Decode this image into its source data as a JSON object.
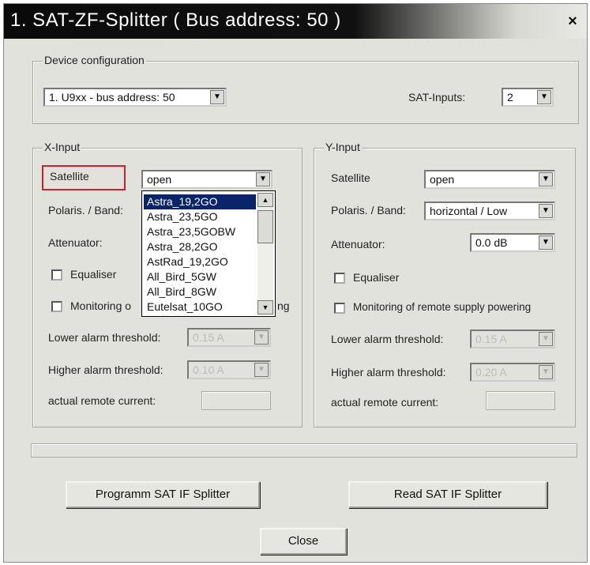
{
  "window": {
    "title": "1. SAT-ZF-Splitter ( Bus address: 50 )",
    "close_glyph": "×"
  },
  "device": {
    "legend": "Device configuration",
    "selected": "1. U9xx - bus address: 50",
    "sat_inputs_label": "SAT-Inputs:",
    "sat_inputs_value": "2"
  },
  "x_input": {
    "legend": "X-Input",
    "satellite_label": "Satellite",
    "satellite_value": "open",
    "polaris_label": "Polaris. / Band:",
    "attenuator_label": "Attenuator:",
    "equaliser_label": "Equaliser",
    "monitoring_label": "Monitoring o",
    "monitoring_tail": "ng",
    "lower_label": "Lower alarm threshold:",
    "lower_value": "0.15 A",
    "higher_label": "Higher alarm threshold:",
    "higher_value": "0.10 A",
    "current_label": "actual remote current:",
    "dropdown_items": [
      "Astra_19,2GO",
      "Astra_23,5GO",
      "Astra_23,5GOBW",
      "Astra_28,2GO",
      "AstRad_19,2GO",
      "All_Bird_5GW",
      "All_Bird_8GW",
      "Eutelsat_10GO"
    ],
    "dropdown_selected_index": 0
  },
  "y_input": {
    "legend": "Y-Input",
    "satellite_label": "Satellite",
    "satellite_value": "open",
    "polaris_label": "Polaris. / Band:",
    "polaris_value": "horizontal / Low",
    "attenuator_label": "Attenuator:",
    "attenuator_value": "0.0 dB",
    "equaliser_label": "Equaliser",
    "monitoring_label": "Monitoring of remote supply powering",
    "lower_label": "Lower alarm threshold:",
    "lower_value": "0.15 A",
    "higher_label": "Higher alarm threshold:",
    "higher_value": "0.20 A",
    "current_label": "actual remote current:"
  },
  "buttons": {
    "program": "Programm SAT IF Splitter",
    "read": "Read SAT IF Splitter",
    "close": "Close"
  },
  "icons": {
    "dropdown_arrow": "▼",
    "scroll_up": "▲",
    "scroll_down": "▼"
  }
}
